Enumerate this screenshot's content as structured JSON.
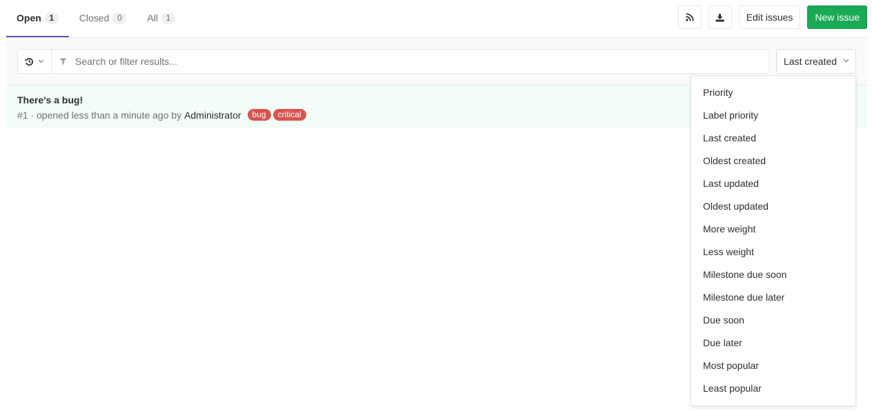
{
  "tabs": [
    {
      "label": "Open",
      "count": "1"
    },
    {
      "label": "Closed",
      "count": "0"
    },
    {
      "label": "All",
      "count": "1"
    }
  ],
  "actions": {
    "rss_icon": "rss-icon",
    "download_icon": "download-icon",
    "edit_issues_label": "Edit issues",
    "new_issue_label": "New issue"
  },
  "filter": {
    "history_icon": "history-icon",
    "search_placeholder": "Search or filter results...",
    "sort_selected": "Last created"
  },
  "issues": [
    {
      "title": "There's a bug!",
      "meta": "#1 · opened less than a minute ago by ",
      "author": "Administrator",
      "labels": [
        {
          "text": "bug",
          "color": "#d9534f"
        },
        {
          "text": "critical",
          "color": "#d9534f"
        }
      ]
    }
  ],
  "sort_options": [
    "Priority",
    "Label priority",
    "Last created",
    "Oldest created",
    "Last updated",
    "Oldest updated",
    "More weight",
    "Less weight",
    "Milestone due soon",
    "Milestone due later",
    "Due soon",
    "Due later",
    "Most popular",
    "Least popular"
  ],
  "colors": {
    "accent": "#6b4fbb",
    "success": "#1aaa55",
    "issue_bg": "#f1fdf6"
  }
}
